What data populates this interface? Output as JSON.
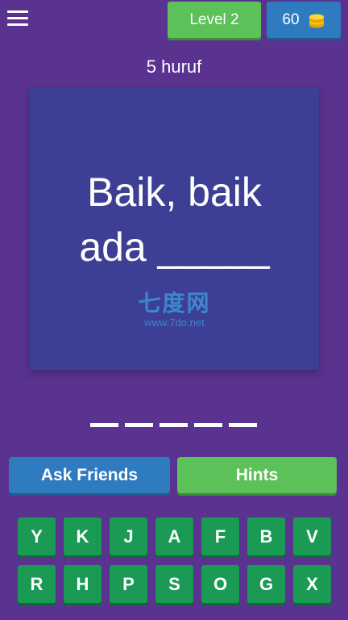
{
  "header": {
    "menu_icon": "hamburger-menu-icon",
    "level_label": "Level 2",
    "coins": "60",
    "coin_icon": "coins-stack-icon"
  },
  "puzzle": {
    "letter_count_label": "5 huruf",
    "question": "Baik, baik\nada _____",
    "answer_slots": 5
  },
  "watermark": {
    "logo_text": "七度网",
    "url": "www.7do.net"
  },
  "actions": {
    "ask_friends_label": "Ask Friends",
    "hints_label": "Hints"
  },
  "keyboard": {
    "rows": [
      [
        "Y",
        "K",
        "J",
        "A",
        "F",
        "B",
        "V"
      ],
      [
        "R",
        "H",
        "P",
        "S",
        "O",
        "G",
        "X"
      ]
    ]
  },
  "colors": {
    "background": "#5a3290",
    "card": "#3c3f93",
    "green_button": "#5cc159",
    "blue_button": "#2f7bc0",
    "key": "#1a9a54"
  }
}
